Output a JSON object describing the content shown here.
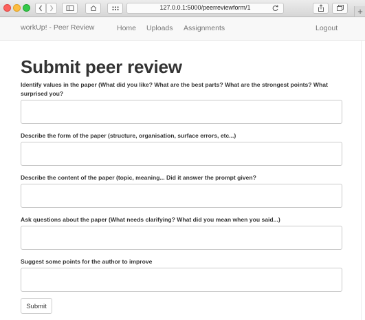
{
  "browser": {
    "url": "127.0.0.1:5000/peerreviewform/1",
    "new_tab_label": "+"
  },
  "navbar": {
    "brand": "workUp! - Peer Review",
    "links": [
      "Home",
      "Uploads",
      "Assignments"
    ],
    "logout": "Logout"
  },
  "page": {
    "title": "Submit peer review",
    "fields": [
      {
        "label": "Identify values in the paper (What did you like? What are the best parts? What are the strongest points? What surprised you?",
        "value": ""
      },
      {
        "label": "Describe the form of the paper (structure, organisation, surface errors, etc...)",
        "value": ""
      },
      {
        "label": "Describe the content of the paper (topic, meaning... Did it answer the prompt given?",
        "value": ""
      },
      {
        "label": "Ask questions about the paper (What needs clarifying? What did you mean when you said...)",
        "value": ""
      },
      {
        "label": "Suggest some points for the author to improve",
        "value": ""
      }
    ],
    "submit_label": "Submit"
  }
}
